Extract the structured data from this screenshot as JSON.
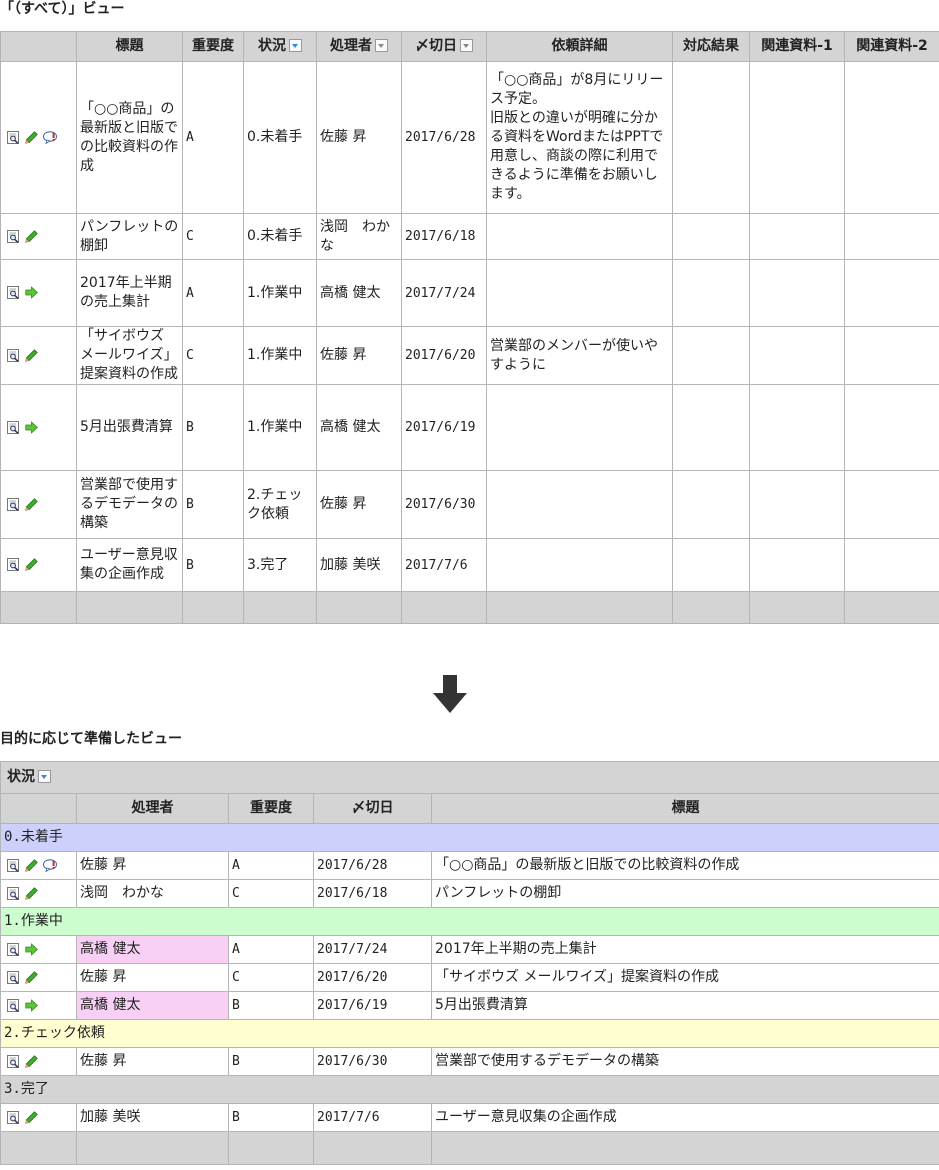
{
  "section1": {
    "title": "「（すべて）」ビュー",
    "headers": [
      "",
      "標題",
      "重要度",
      "状況",
      "処理者",
      "〆切日",
      "依頼詳細",
      "対応結果",
      "関連資料-1",
      "関連資料-2"
    ],
    "rows": [
      {
        "icons": [
          "view-icon",
          "edit-icon",
          "comment-icon"
        ],
        "title": "「○○商品」の最新版と旧版での比較資料の作成",
        "priority": "A",
        "status": "0.未着手",
        "assignee": "佐藤 昇",
        "due": "2017/6/28",
        "detail": "「○○商品」が8月にリリース予定。\n旧版との違いが明確に分かる資料をWordまたはPPTで用意し、商談の際に利用できるように準備をお願いします。",
        "result": "",
        "ref1": "",
        "ref2": ""
      },
      {
        "icons": [
          "view-icon",
          "edit-icon"
        ],
        "title": "パンフレットの棚卸",
        "priority": "C",
        "status": "0.未着手",
        "assignee": "浅岡　わかな",
        "due": "2017/6/18",
        "detail": "",
        "result": "",
        "ref1": "",
        "ref2": ""
      },
      {
        "icons": [
          "view-icon",
          "arrow-icon"
        ],
        "title": "2017年上半期の売上集計",
        "priority": "A",
        "status": "1.作業中",
        "assignee": "高橋 健太",
        "due": "2017/7/24",
        "detail": "",
        "result": "",
        "ref1": "",
        "ref2": ""
      },
      {
        "icons": [
          "view-icon",
          "edit-icon"
        ],
        "title": "「サイボウズ メールワイズ」提案資料の作成",
        "priority": "C",
        "status": "1.作業中",
        "assignee": "佐藤 昇",
        "due": "2017/6/20",
        "detail": "営業部のメンバーが使いやすように",
        "result": "",
        "ref1": "",
        "ref2": ""
      },
      {
        "icons": [
          "view-icon",
          "arrow-icon"
        ],
        "title": "5月出張費清算",
        "priority": "B",
        "status": "1.作業中",
        "assignee": "高橋 健太",
        "due": "2017/6/19",
        "detail": "",
        "result": "",
        "ref1": "",
        "ref2": ""
      },
      {
        "icons": [
          "view-icon",
          "edit-icon"
        ],
        "title": "営業部で使用するデモデータの構築",
        "priority": "B",
        "status": "2.チェック依頼",
        "assignee": "佐藤 昇",
        "due": "2017/6/30",
        "detail": "",
        "result": "",
        "ref1": "",
        "ref2": ""
      },
      {
        "icons": [
          "view-icon",
          "edit-icon"
        ],
        "title": "ユーザー意見収集の企画作成",
        "priority": "B",
        "status": "3.完了",
        "assignee": "加藤 美咲",
        "due": "2017/7/6",
        "detail": "",
        "result": "",
        "ref1": "",
        "ref2": ""
      }
    ]
  },
  "section2": {
    "title": "目的に応じて準備したビュー",
    "group_label": "状況",
    "headers": [
      "",
      "処理者",
      "重要度",
      "〆切日",
      "標題"
    ],
    "groups": [
      {
        "label": "0.未着手",
        "color": "#cdd0fb",
        "rows": [
          {
            "icons": [
              "view-icon",
              "edit-icon",
              "comment-icon"
            ],
            "assignee": "佐藤 昇",
            "priority": "A",
            "due": "2017/6/28",
            "title": "「○○商品」の最新版と旧版での比較資料の作成",
            "highlight": false
          },
          {
            "icons": [
              "view-icon",
              "edit-icon"
            ],
            "assignee": "浅岡　わかな",
            "priority": "C",
            "due": "2017/6/18",
            "title": "パンフレットの棚卸",
            "highlight": false
          }
        ]
      },
      {
        "label": "1.作業中",
        "color": "#cdfcce",
        "rows": [
          {
            "icons": [
              "view-icon",
              "arrow-icon"
            ],
            "assignee": "高橋 健太",
            "priority": "A",
            "due": "2017/7/24",
            "title": "2017年上半期の売上集計",
            "highlight": true
          },
          {
            "icons": [
              "view-icon",
              "edit-icon"
            ],
            "assignee": "佐藤 昇",
            "priority": "C",
            "due": "2017/6/20",
            "title": "「サイボウズ メールワイズ」提案資料の作成",
            "highlight": false
          },
          {
            "icons": [
              "view-icon",
              "arrow-icon"
            ],
            "assignee": "高橋 健太",
            "priority": "B",
            "due": "2017/6/19",
            "title": "5月出張費清算",
            "highlight": true
          }
        ]
      },
      {
        "label": "2.チェック依頼",
        "color": "#fefed0",
        "rows": [
          {
            "icons": [
              "view-icon",
              "edit-icon"
            ],
            "assignee": "佐藤 昇",
            "priority": "B",
            "due": "2017/6/30",
            "title": "営業部で使用するデモデータの構築",
            "highlight": false
          }
        ]
      },
      {
        "label": "3.完了",
        "color": "#d4d4d4",
        "rows": [
          {
            "icons": [
              "view-icon",
              "edit-icon"
            ],
            "assignee": "加藤 美咲",
            "priority": "B",
            "due": "2017/7/6",
            "title": "ユーザー意見収集の企画作成",
            "highlight": false
          }
        ]
      }
    ]
  },
  "colors": {
    "header_bg": "#d4d4d4",
    "highlight": "#f8d0f6",
    "border": "#b5b5b5"
  }
}
